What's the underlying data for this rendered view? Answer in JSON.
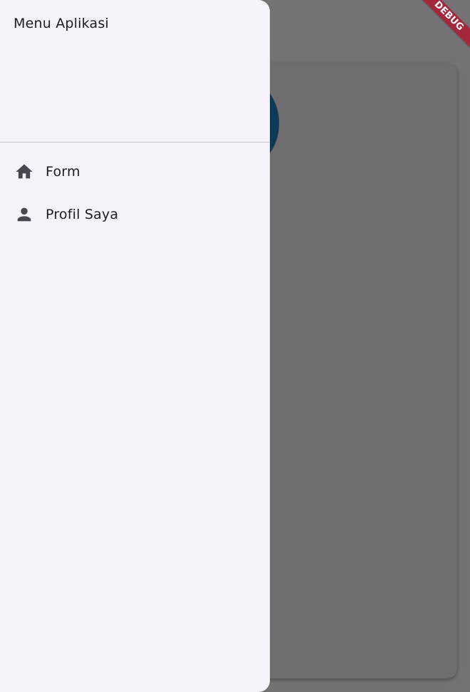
{
  "drawer": {
    "title": "Menu Aplikasi",
    "items": [
      {
        "label": "Form",
        "icon": "home-icon"
      },
      {
        "label": "Profil Saya",
        "icon": "person-icon"
      }
    ]
  },
  "debug_banner": {
    "label": "DEBUG",
    "color": "#a6263b"
  },
  "colors": {
    "drawer_background": "#f7f2fa",
    "scrim": "rgba(0,0,0,0.54)",
    "avatar_accent": "#1f7fc4"
  }
}
